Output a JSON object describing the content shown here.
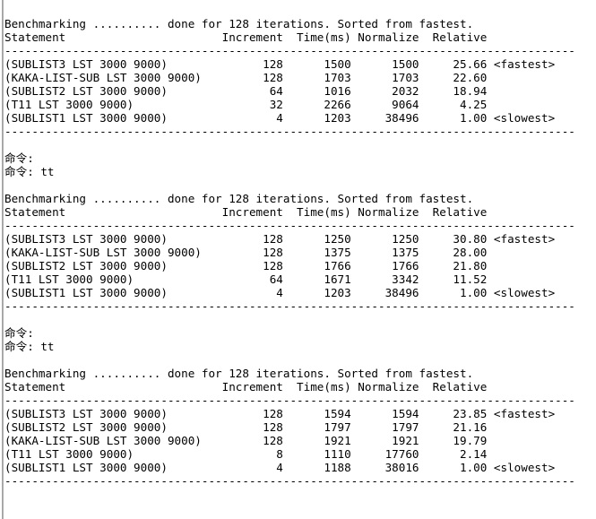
{
  "window": {
    "kind": "console-output",
    "background_color": "#ffffff",
    "text_color": "#000000",
    "edge_color": "#8f8f8f"
  },
  "separator": {
    "char": "-",
    "length": 84,
    "text": "------------------------------------------------------------------------------------"
  },
  "blank_line": "",
  "prompt": {
    "empty": "命令:",
    "with_command": "命令: tt",
    "label": "命令:",
    "command": "tt"
  },
  "benchmark_header": {
    "banner": "Benchmarking .......... done for 128 iterations. Sorted from fastest.",
    "iterations": "128",
    "dots": "..........",
    "columns_line": "Statement                       Increment  Time(ms) Normalize  Relative",
    "columns": [
      "Statement",
      "Increment",
      "Time(ms)",
      "Normalize",
      "Relative"
    ]
  },
  "blocks": [
    {
      "id": "run-1",
      "banner": "Benchmarking .......... done for 128 iterations. Sorted from fastest.",
      "columns_line": "Statement                       Increment  Time(ms) Normalize  Relative",
      "rows": [
        {
          "statement": "(SUBLIST3 LST 3000 9000)",
          "increment": "128",
          "time_ms": "1500",
          "normalize": "1500",
          "relative": "25.66",
          "note": "<fastest>"
        },
        {
          "statement": "(KAKA-LIST-SUB LST 3000 9000)",
          "increment": "128",
          "time_ms": "1703",
          "normalize": "1703",
          "relative": "22.60",
          "note": ""
        },
        {
          "statement": "(SUBLIST2 LST 3000 9000)",
          "increment": "64",
          "time_ms": "1016",
          "normalize": "2032",
          "relative": "18.94",
          "note": ""
        },
        {
          "statement": "(T11 LST 3000 9000)",
          "increment": "32",
          "time_ms": "2266",
          "normalize": "9064",
          "relative": "4.25",
          "note": ""
        },
        {
          "statement": "(SUBLIST1 LST 3000 9000)",
          "increment": "4",
          "time_ms": "1203",
          "normalize": "38496",
          "relative": "1.00",
          "note": "<slowest>"
        }
      ],
      "rendered": [
        "(SUBLIST3 LST 3000 9000)              128      1500      1500     25.66 <fastest>",
        "(KAKA-LIST-SUB LST 3000 9000)         128      1703      1703     22.60",
        "(SUBLIST2 LST 3000 9000)               64      1016      2032     18.94",
        "(T11 LST 3000 9000)                    32      2266      9064      4.25",
        "(SUBLIST1 LST 3000 9000)                4      1203     38496      1.00 <slowest>"
      ]
    },
    {
      "id": "run-2",
      "banner": "Benchmarking .......... done for 128 iterations. Sorted from fastest.",
      "columns_line": "Statement                       Increment  Time(ms) Normalize  Relative",
      "rows": [
        {
          "statement": "(SUBLIST3 LST 3000 9000)",
          "increment": "128",
          "time_ms": "1250",
          "normalize": "1250",
          "relative": "30.80",
          "note": "<fastest>"
        },
        {
          "statement": "(KAKA-LIST-SUB LST 3000 9000)",
          "increment": "128",
          "time_ms": "1375",
          "normalize": "1375",
          "relative": "28.00",
          "note": ""
        },
        {
          "statement": "(SUBLIST2 LST 3000 9000)",
          "increment": "128",
          "time_ms": "1766",
          "normalize": "1766",
          "relative": "21.80",
          "note": ""
        },
        {
          "statement": "(T11 LST 3000 9000)",
          "increment": "64",
          "time_ms": "1671",
          "normalize": "3342",
          "relative": "11.52",
          "note": ""
        },
        {
          "statement": "(SUBLIST1 LST 3000 9000)",
          "increment": "4",
          "time_ms": "1203",
          "normalize": "38496",
          "relative": "1.00",
          "note": "<slowest>"
        }
      ],
      "rendered": [
        "(SUBLIST3 LST 3000 9000)              128      1250      1250     30.80 <fastest>",
        "(KAKA-LIST-SUB LST 3000 9000)         128      1375      1375     28.00",
        "(SUBLIST2 LST 3000 9000)              128      1766      1766     21.80",
        "(T11 LST 3000 9000)                    64      1671      3342     11.52",
        "(SUBLIST1 LST 3000 9000)                4      1203     38496      1.00 <slowest>"
      ]
    },
    {
      "id": "run-3",
      "banner": "Benchmarking .......... done for 128 iterations. Sorted from fastest.",
      "columns_line": "Statement                       Increment  Time(ms) Normalize  Relative",
      "rows": [
        {
          "statement": "(SUBLIST3 LST 3000 9000)",
          "increment": "128",
          "time_ms": "1594",
          "normalize": "1594",
          "relative": "23.85",
          "note": "<fastest>"
        },
        {
          "statement": "(SUBLIST2 LST 3000 9000)",
          "increment": "128",
          "time_ms": "1797",
          "normalize": "1797",
          "relative": "21.16",
          "note": ""
        },
        {
          "statement": "(KAKA-LIST-SUB LST 3000 9000)",
          "increment": "128",
          "time_ms": "1921",
          "normalize": "1921",
          "relative": "19.79",
          "note": ""
        },
        {
          "statement": "(T11 LST 3000 9000)",
          "increment": "8",
          "time_ms": "1110",
          "normalize": "17760",
          "relative": "2.14",
          "note": ""
        },
        {
          "statement": "(SUBLIST1 LST 3000 9000)",
          "increment": "4",
          "time_ms": "1188",
          "normalize": "38016",
          "relative": "1.00",
          "note": "<slowest>"
        }
      ],
      "rendered": [
        "(SUBLIST3 LST 3000 9000)              128      1594      1594     23.85 <fastest>",
        "(SUBLIST2 LST 3000 9000)              128      1797      1797     21.16",
        "(KAKA-LIST-SUB LST 3000 9000)         128      1921      1921     19.79",
        "(T11 LST 3000 9000)                     8      1110     17760      2.14",
        "(SUBLIST1 LST 3000 9000)                4      1188     38016      1.00 <slowest>"
      ]
    }
  ],
  "full_text": "\nBenchmarking .......... done for 128 iterations. Sorted from fastest.\nStatement                       Increment  Time(ms) Normalize  Relative\n------------------------------------------------------------------------------------\n(SUBLIST3 LST 3000 9000)              128      1500      1500     25.66 <fastest>\n(KAKA-LIST-SUB LST 3000 9000)         128      1703      1703     22.60\n(SUBLIST2 LST 3000 9000)               64      1016      2032     18.94\n(T11 LST 3000 9000)                    32      2266      9064      4.25\n(SUBLIST1 LST 3000 9000)                4      1203     38496      1.00 <slowest>\n------------------------------------------------------------------------------------\n\n命令:\n命令: tt\n\nBenchmarking .......... done for 128 iterations. Sorted from fastest.\nStatement                       Increment  Time(ms) Normalize  Relative\n------------------------------------------------------------------------------------\n(SUBLIST3 LST 3000 9000)              128      1250      1250     30.80 <fastest>\n(KAKA-LIST-SUB LST 3000 9000)         128      1375      1375     28.00\n(SUBLIST2 LST 3000 9000)              128      1766      1766     21.80\n(T11 LST 3000 9000)                    64      1671      3342     11.52\n(SUBLIST1 LST 3000 9000)                4      1203     38496      1.00 <slowest>\n------------------------------------------------------------------------------------\n\n命令:\n命令: tt\n\nBenchmarking .......... done for 128 iterations. Sorted from fastest.\nStatement                       Increment  Time(ms) Normalize  Relative\n------------------------------------------------------------------------------------\n(SUBLIST3 LST 3000 9000)              128      1594      1594     23.85 <fastest>\n(SUBLIST2 LST 3000 9000)              128      1797      1797     21.16\n(KAKA-LIST-SUB LST 3000 9000)         128      1921      1921     19.79\n(T11 LST 3000 9000)                     8      1110     17760      2.14\n(SUBLIST1 LST 3000 9000)                4      1188     38016      1.00 <slowest>\n------------------------------------------------------------------------------------"
}
